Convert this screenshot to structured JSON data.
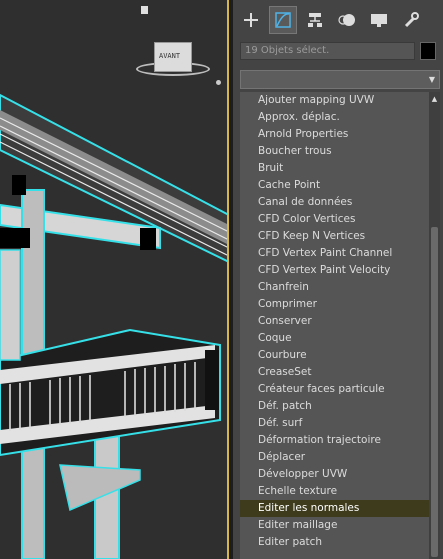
{
  "viewcube": {
    "label": "AVANT"
  },
  "panel": {
    "tabs": [
      "create-tab",
      "modify-tab",
      "hierarchy-tab",
      "motion-tab",
      "display-tab",
      "utilities-tab"
    ],
    "selection_text": "19 Objets sélect.",
    "modifier_dropdown_value": "",
    "modifiers": [
      "Ajouter mapping UVW",
      "Approx. déplac.",
      "Arnold Properties",
      "Boucher trous",
      "Bruit",
      "Cache Point",
      "Canal de données",
      "CFD Color Vertices",
      "CFD Keep N Vertices",
      "CFD Vertex Paint Channel",
      "CFD Vertex Paint Velocity",
      "Chanfrein",
      "Comprimer",
      "Conserver",
      "Coque",
      "Courbure",
      "CreaseSet",
      "Créateur faces particule",
      "Déf. patch",
      "Déf. surf",
      "Déformation trajectoire",
      "Déplacer",
      "Développer UVW",
      "Echelle texture",
      "Editer les normales",
      "Editer maillage",
      "Editer patch"
    ],
    "selected_modifier": "Editer les normales"
  },
  "colors": {
    "accent_selected": "#3d3b1b",
    "selection_outline": "#36e0e8",
    "viewport_border": "#d8b74a"
  }
}
